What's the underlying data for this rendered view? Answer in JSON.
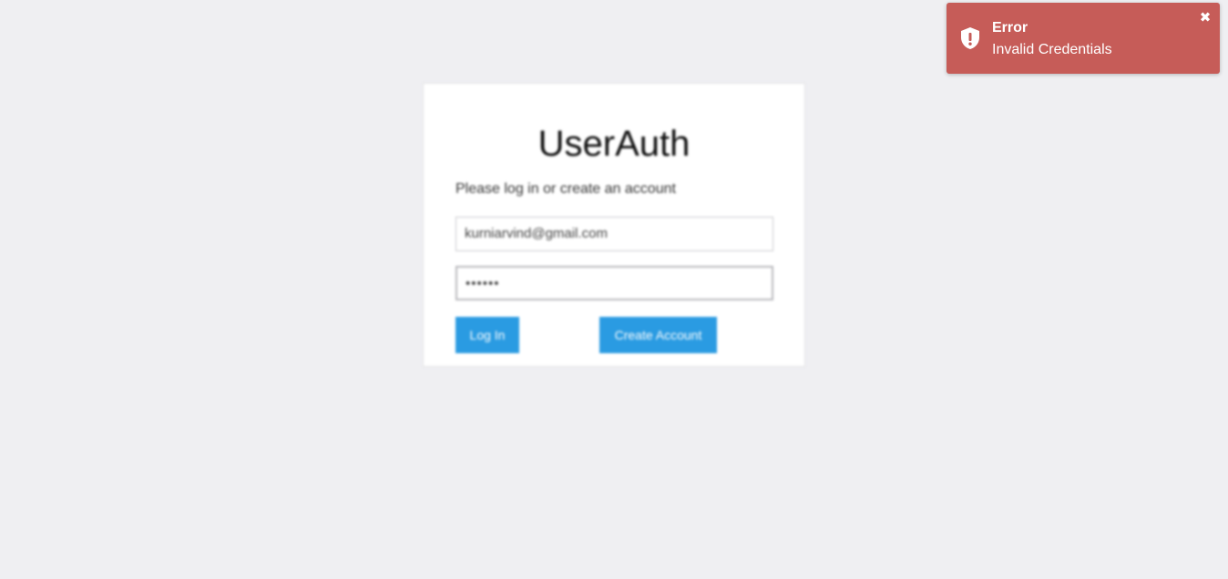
{
  "login_card": {
    "title": "UserAuth",
    "subtitle": "Please log in or create an account",
    "email_value": "kurniarvind@gmail.com",
    "password_value": "••••••",
    "login_button": "Log In",
    "create_account_button": "Create Account"
  },
  "toast": {
    "title": "Error",
    "message": "Invalid Credentials",
    "close_glyph": "✖",
    "icon": "shield-exclamation-icon"
  },
  "colors": {
    "page_background": "#efeff2",
    "button_blue": "#2a9be2",
    "toast_red": "#c65c58"
  }
}
